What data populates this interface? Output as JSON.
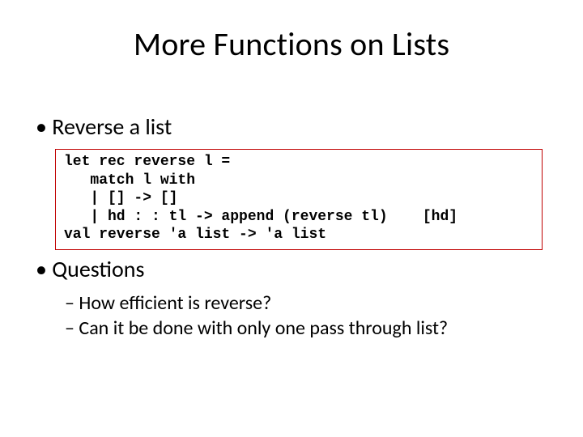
{
  "title": "More Functions on Lists",
  "bullets": {
    "reverse": "Reverse a list",
    "questions": "Questions",
    "q1": "How efficient is reverse?",
    "q2": "Can it be done with only one pass through list?"
  },
  "code": {
    "l1": "let rec reverse l =",
    "l2": "   match l with",
    "l3": "   | [] -> []",
    "l4": "   | hd : : tl -> append (reverse tl)    [hd]",
    "l5": "val reverse 'a list -> 'a list"
  }
}
